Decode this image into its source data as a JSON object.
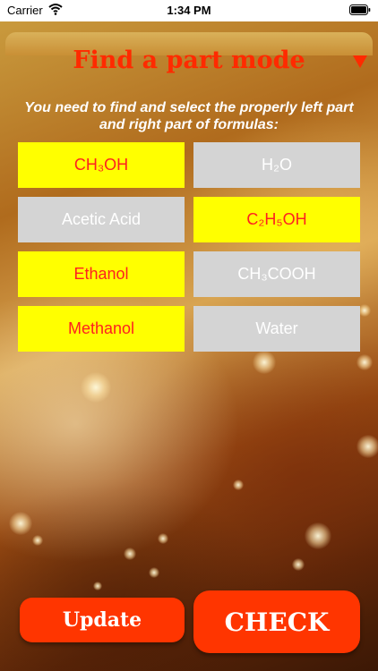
{
  "status_bar": {
    "carrier": "Carrier",
    "time": "1:34 PM"
  },
  "header": {
    "title": "Find  a part mode",
    "menu_icon": "triangle-down-icon"
  },
  "instruction": "You need to find and select the properly left part and right part of formulas:",
  "tiles": [
    {
      "label": "CH₃OH",
      "style": "yellow"
    },
    {
      "label": "H₂O",
      "style": "gray"
    },
    {
      "label": "Acetic Acid",
      "style": "gray"
    },
    {
      "label": "C₂H₅OH",
      "style": "yellow"
    },
    {
      "label": "Ethanol",
      "style": "yellow"
    },
    {
      "label": "CH₃COOH",
      "style": "gray"
    },
    {
      "label": "Methanol",
      "style": "yellow"
    },
    {
      "label": "Water",
      "style": "gray"
    }
  ],
  "buttons": {
    "update": "Update",
    "check": "CHECK"
  },
  "colors": {
    "accent": "#ff3500",
    "tile_selected": "#ffff00",
    "tile_idle": "#d4d4d4",
    "title": "#ff2a00"
  }
}
